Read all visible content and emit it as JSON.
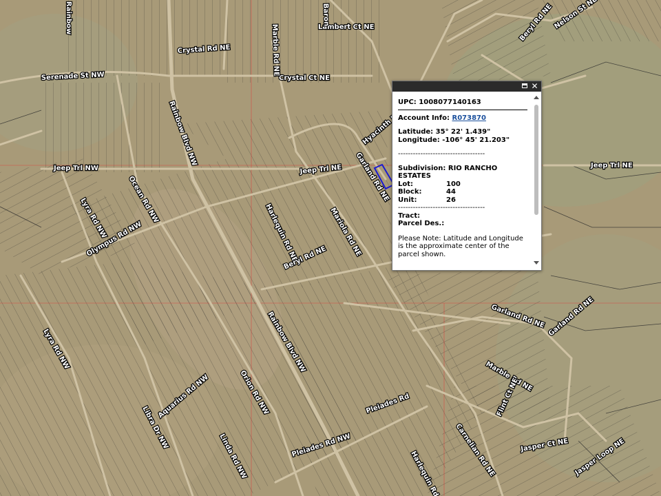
{
  "map": {
    "road_labels": [
      "Lambert Ct NE",
      "Crystal Rd NE",
      "Crystal Ct NE",
      "Serenade St NW",
      "Rainbow Blvd NW",
      "Jeep Trl NW",
      "Jeep Trl NE",
      "Jeep Trl NE",
      "Ocean Rd NW",
      "Lyra Rd NW",
      "Olympus Rd NW",
      "Harlequin Rd NE",
      "Beryl Rd NE",
      "Mariola Rd NE",
      "Garland Rd NE",
      "Garland Rd NE",
      "Garland Rd NE",
      "Marble Rd NE",
      "Flint Ct NE",
      "Jasper Ct NE",
      "Jasper Loop NE",
      "Rainbow Blvd NW",
      "Orion Rd NW",
      "Pleiades Rd",
      "Pleiades Rd NW",
      "Carnelian Rd NE",
      "Harlequin Rd NE",
      "Linda Rd NW",
      "Aquarius Rd NW",
      "Libra Dr NW",
      "Lyra Rd NW",
      "Beryl Rd NE",
      "Nelson St NE",
      "Marble Rd NE",
      "Baron",
      "Hyacinth Rd",
      "Rainbow"
    ],
    "selected_parcel_color": "#1a1ad0",
    "boundary_line_color": "#e53030"
  },
  "popup": {
    "upc_label": "UPC:",
    "upc_value": "1008077140163",
    "account_label": "Account Info:",
    "account_value": "R073870",
    "latitude_label": "Latitude:",
    "latitude_value": "35° 22' 1.439\"",
    "longitude_label": "Longitude:",
    "longitude_value": "-106° 45' 21.203\"",
    "divider_text": "-----------------------------------",
    "subdivision_label": "Subdivision:",
    "subdivision_value": "RIO RANCHO ESTATES",
    "lot_label": "Lot:",
    "lot_value": "100",
    "block_label": "Block:",
    "block_value": "44",
    "unit_label": "Unit:",
    "unit_value": "26",
    "divider_text_2": "-----------------------------------",
    "tract_label": "Tract:",
    "parcel_des_label": "Parcel Des.:",
    "note": "Please Note: Latitude and Longitude is the approximate center of the parcel shown."
  }
}
